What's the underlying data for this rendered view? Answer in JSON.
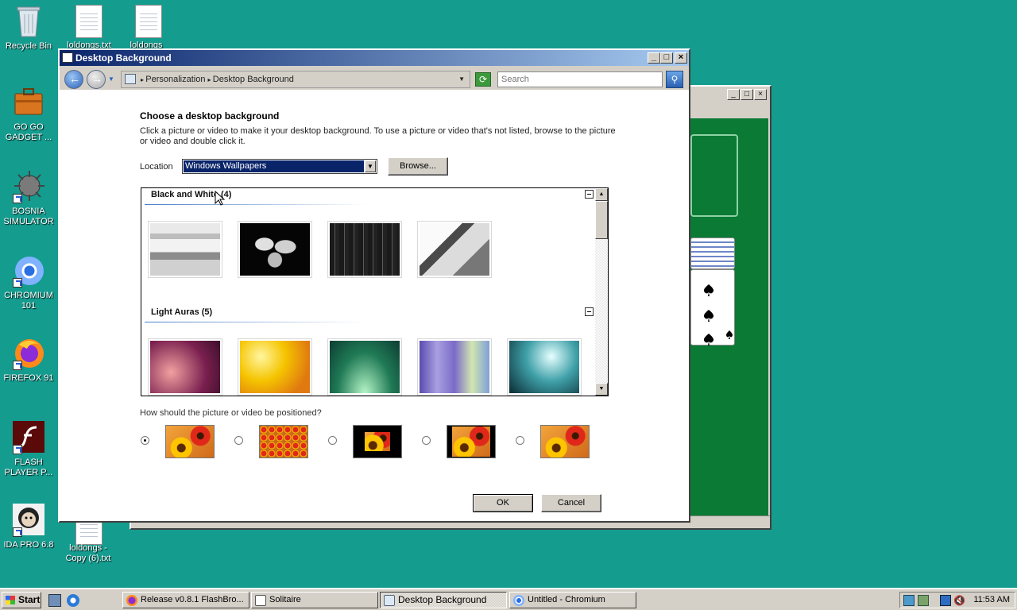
{
  "desktop": {
    "icons": [
      {
        "label": "Recycle Bin"
      },
      {
        "label": "loldongs.txt"
      },
      {
        "label": "loldongs"
      },
      {
        "label": "GO GO GADGET ..."
      },
      {
        "label": "BOSNIA SIMULATOR"
      },
      {
        "label": "CHROMIUM 101"
      },
      {
        "label": "FIREFOX 91"
      },
      {
        "label": "FLASH PLAYER P..."
      },
      {
        "label": "IDA PRO 6.8"
      },
      {
        "label": "loldongs - Copy (6).txt"
      }
    ]
  },
  "dialog": {
    "title": "Desktop Background",
    "breadcrumb": [
      "Personalization",
      "Desktop Background"
    ],
    "search_placeholder": "Search",
    "heading": "Choose a desktop background",
    "description": "Click a picture or video to make it your desktop background. To use a picture or video that's not listed, browse to the picture or video and double click it.",
    "location_label": "Location",
    "location_value": "Windows Wallpapers",
    "browse_label": "Browse...",
    "groups": [
      {
        "title": "Black and White (4)",
        "count": 4
      },
      {
        "title": "Light Auras (5)",
        "count": 5
      }
    ],
    "position_question": "How should the picture or video be positioned?",
    "position_options": [
      "fill",
      "tile",
      "center",
      "fit",
      "stretch"
    ],
    "position_selected": "fill",
    "ok_label": "OK",
    "cancel_label": "Cancel"
  },
  "taskbar": {
    "start_label": "Start",
    "tasks": [
      {
        "label": "Release v0.8.1 FlashBro...",
        "active": false
      },
      {
        "label": "Solitaire",
        "active": false
      },
      {
        "label": "Desktop Background",
        "active": true
      },
      {
        "label": "Untitled - Chromium",
        "active": false
      }
    ],
    "clock": "11:53 AM"
  },
  "colors": {
    "desktop": "#149c8f",
    "title_active": "#0a246a",
    "felt": "#0a7a34"
  }
}
